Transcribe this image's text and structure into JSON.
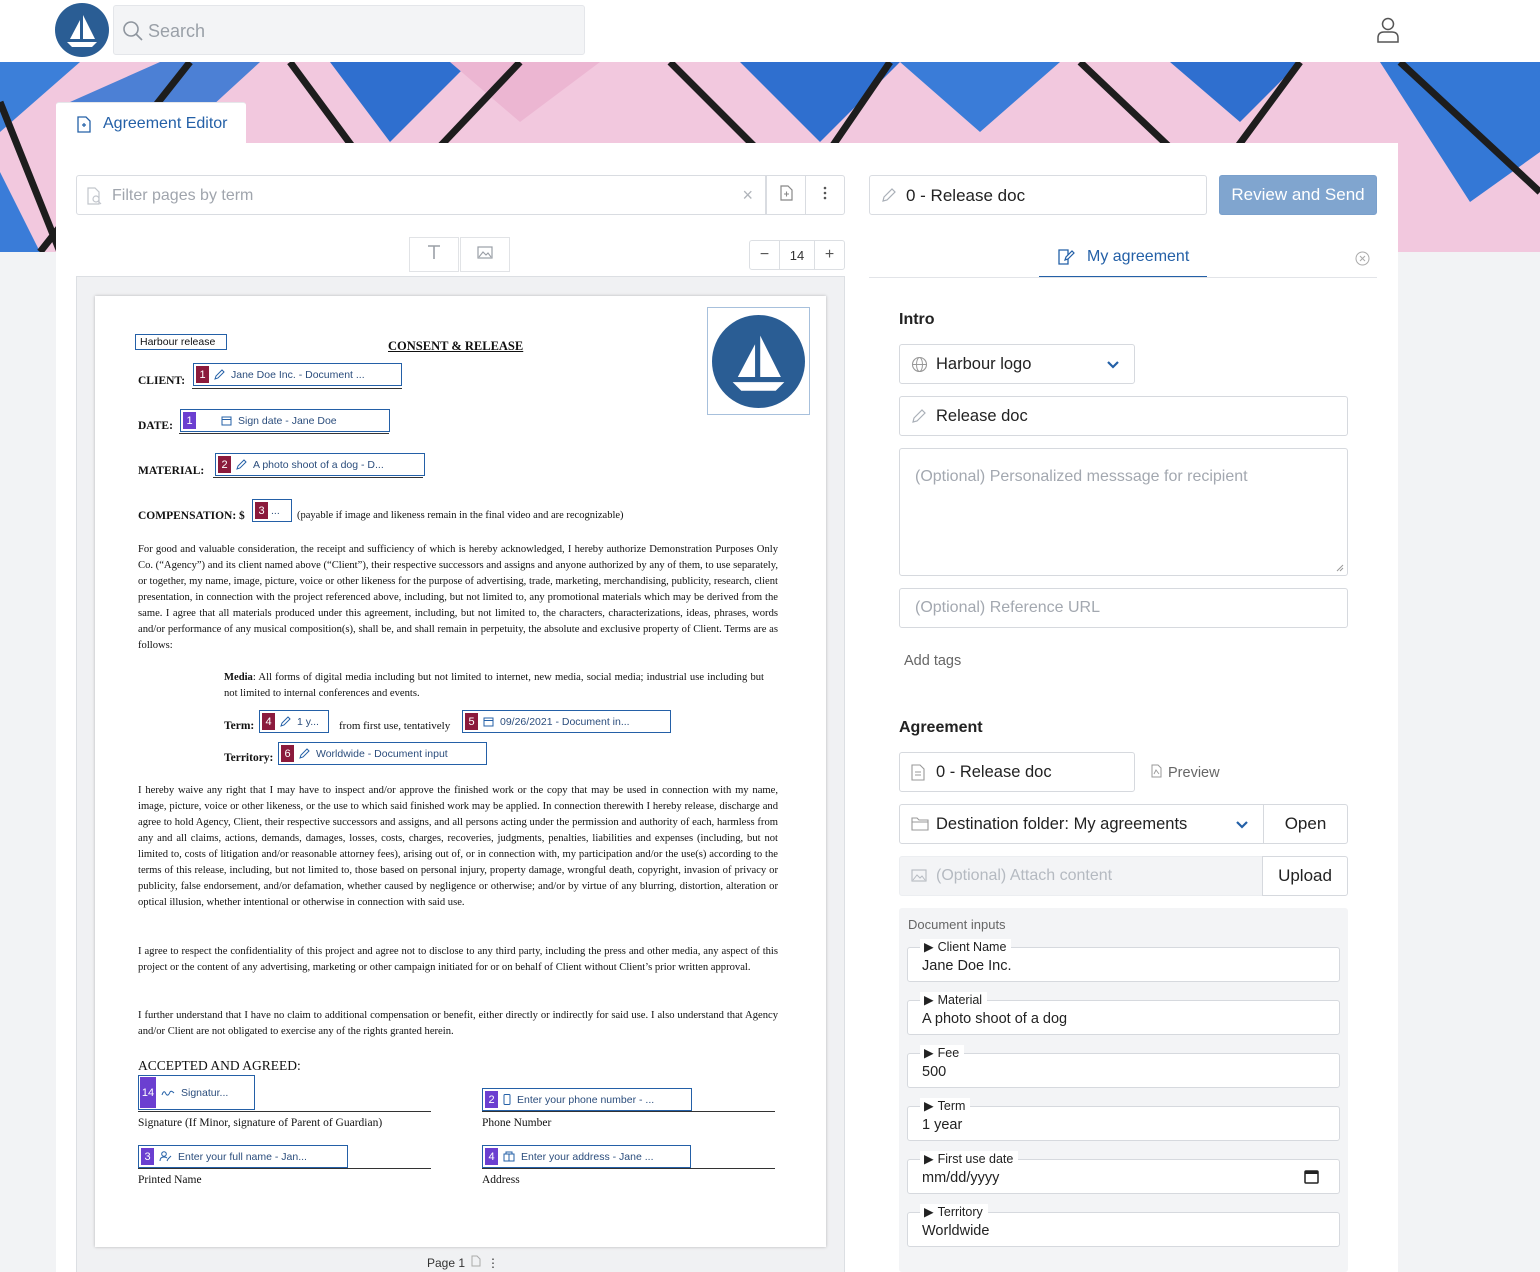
{
  "header": {
    "search_placeholder": "Search"
  },
  "tab": {
    "label": "Agreement Editor"
  },
  "left_toolbar": {
    "filter_placeholder": "Filter pages by term",
    "clear_symbol": "×",
    "zoom_minus": "−",
    "zoom_value": "14",
    "zoom_plus": "+"
  },
  "doc_name": "0 - Release doc",
  "review_button": "Review and Send",
  "document": {
    "header_field": "Harbour release",
    "title": "CONSENT & RELEASE",
    "labels": {
      "client": "CLIENT:",
      "date": "DATE:",
      "material": "MATERIAL:",
      "compensation": "COMPENSATION: $",
      "compensation_note": "(payable if image and likeness remain in the final video and are recognizable)",
      "media_term": "Media",
      "media_text": ": All forms of digital media including but not limited to internet, new media, social media; industrial use including but not limited to internal conferences and events.",
      "term": "Term:",
      "term_mid": "from first use, tentatively",
      "territory": "Territory:",
      "accepted": "ACCEPTED AND AGREED:",
      "signature_caption": "Signature (If Minor, signature of Parent of Guardian)",
      "phone_caption": "Phone Number",
      "printed_caption": "Printed Name",
      "address_caption": "Address"
    },
    "fields": {
      "client": {
        "num": "1",
        "text": "Jane Doe Inc.  -  Document ..."
      },
      "date": {
        "num": "1",
        "text": "Sign date  -  Jane Doe"
      },
      "material": {
        "num": "2",
        "text": "A photo shoot of a dog  -  D..."
      },
      "compensation": {
        "num": "3",
        "text": "..."
      },
      "term": {
        "num": "4",
        "text": "1 y..."
      },
      "first_use": {
        "num": "5",
        "text": "09/26/2021  -  Document in..."
      },
      "territory": {
        "num": "6",
        "text": "Worldwide  -  Document input"
      },
      "signature": {
        "num": "14",
        "text": "Signatur..."
      },
      "phone": {
        "num": "2",
        "text": "Enter your phone number  -  ..."
      },
      "full_name": {
        "num": "3",
        "text": "Enter your full name  -  Jan..."
      },
      "address": {
        "num": "4",
        "text": "Enter your address  -  Jane ..."
      }
    },
    "paragraphs": [
      "For good and valuable consideration, the receipt and sufficiency of which is hereby acknowledged, I hereby authorize Demonstration Purposes Only Co. (“Agency”) and its client named above (“Client”), their respective successors and assigns and anyone authorized by any of them, to use separately, or together, my name, image, picture, voice or other likeness for the purpose of advertising, trade, marketing, merchandising, publicity, research, client presentation, in connection with the project referenced above, including, but not limited to, any promotional materials which may be derived from the same.  I agree that all materials produced under this agreement, including, but not limited to, the characters, characterizations, ideas, phrases, words and/or performance of any musical composition(s), shall be, and shall remain in perpetuity, the absolute and exclusive property of Client. Terms are as follows:",
      "I hereby waive any right that I may have to inspect and/or approve the finished work or the copy that may be used in connection with my name, image, picture, voice or other likeness, or the use to which said finished work may be applied. In connection therewith I hereby release, discharge and agree to hold Agency, Client, their respective successors and assigns, and all persons acting under the permission and authority of each, harmless from any and all claims, actions, demands, damages, losses, costs, charges, recoveries, judgments, penalties, liabilities and expenses (including, but not limited to, costs of litigation and/or reasonable attorney fees), arising out of, or in connection with, my participation and/or the use(s) according to the terms of this release, including, but not limited to, those based on personal injury, property damage, wrongful death, copyright, invasion of privacy or publicity, false endorsement, and/or defamation, whether caused by negligence or otherwise; and/or by virtue of any blurring, distortion, alteration or optical illusion, whether intentional or otherwise in connection with said use.",
      "I agree to respect the confidentiality of this project and agree not to disclose to any third party, including the press and other media, any aspect of this project or the content of any advertising, marketing or other campaign initiated for or on behalf of Client without Client’s prior written approval.",
      "I further understand that I have no claim to additional compensation or benefit, either directly or indirectly for said use.  I also understand that Agency and/or Client are not obligated to exercise any of the rights granted herein."
    ],
    "page_label": "Page 1",
    "page_more": "⋮"
  },
  "right": {
    "tab_label": "My agreement",
    "intro_title": "Intro",
    "logo_select": "Harbour logo",
    "title_input": "Release doc",
    "message_placeholder": "(Optional) Personalized messsage for recipient",
    "url_placeholder": "(Optional) Reference URL",
    "add_tags": "Add tags",
    "agreement_title": "Agreement",
    "agreement_doc": "0 - Release doc",
    "preview": "Preview",
    "destination": "Destination folder: My agreements",
    "open_button": "Open",
    "attach_placeholder": "(Optional) Attach content",
    "upload_button": "Upload",
    "doc_inputs_title": "Document inputs",
    "doc_inputs": [
      {
        "label": "Client Name",
        "value": "Jane Doe Inc."
      },
      {
        "label": "Material",
        "value": "A photo shoot of a dog"
      },
      {
        "label": "Fee",
        "value": "500"
      },
      {
        "label": "Term",
        "value": "1 year"
      },
      {
        "label": "First use date",
        "value": "mm/dd/yyyy"
      },
      {
        "label": "Territory",
        "value": "Worldwide"
      }
    ]
  },
  "colors": {
    "accent": "#2460a7",
    "logo_blue": "#2a5d94",
    "primary_button": "#80a5cf",
    "field_number_red": "#8b1a3c",
    "field_number_purple": "#6b3fd0"
  },
  "icons": {
    "logo": "sailboat-logo",
    "search": "search-icon",
    "user": "user-icon"
  }
}
